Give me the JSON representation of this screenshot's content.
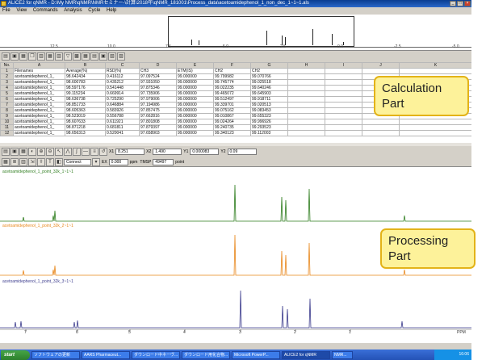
{
  "window": {
    "title": "ALICE2 for qNMR - D:\\My NMR\\qNMR\\NMRセミナー-\\計算\\2018年\\qNMR_181001\\Process_data\\acetoamidephenol_1_non_dec_1~1~1.als",
    "min": "_",
    "max": "□",
    "close": "×"
  },
  "menu": [
    "File",
    "View",
    "Commands",
    "Analysis",
    "Cycle",
    "Help"
  ],
  "overview": {
    "ticks": [
      "12.5",
      "10.0",
      "7.5",
      "5.0",
      "2.5",
      "0.0",
      "-2.5",
      "-5.0"
    ]
  },
  "sheet": {
    "columns": [
      "No.",
      "A",
      "B",
      "C",
      "D",
      "E",
      "F",
      "G",
      "H",
      "I",
      "J",
      "K"
    ],
    "header_row": [
      "1",
      "Filenames",
      "Average(%)",
      "RSD(%)",
      "CH3",
      "ETM(IS)",
      "CH2",
      "CH2"
    ],
    "rows": [
      [
        "2",
        "acetoamidephenol_1_",
        "98.642434",
        "0.416112",
        "97.097524",
        "99.000000",
        "99.799982",
        "99.070766"
      ],
      [
        "3",
        "acetoamidephenol_1_",
        "98.600783",
        "0.435212",
        "97.931050",
        "99.000000",
        "99.745774",
        "99.025518"
      ],
      [
        "4",
        "acetoamidephenol_1_",
        "98.597176",
        "0.541448",
        "97.875346",
        "99.000000",
        "99.022235",
        "99.640246"
      ],
      [
        "5",
        "acetoamidephenol_1_",
        "99.115234",
        "0.669914",
        "97.735906",
        "99.000000",
        "99.465072",
        "99.645903"
      ],
      [
        "6",
        "acetoamidephenol_1_",
        "98.636738",
        "0.725290",
        "97.979006",
        "99.000000",
        "99.512497",
        "99.918711"
      ],
      [
        "7",
        "acetoamidephenol_1_",
        "98.851733",
        "0.646884",
        "97.194986",
        "99.000000",
        "99.339701",
        "99.020513"
      ],
      [
        "8",
        "acetoamidephenol_1_",
        "98.605363",
        "0.583926",
        "97.857475",
        "99.000000",
        "99.075162",
        "99.083453"
      ],
      [
        "9",
        "acetoamidephenol_1_",
        "98.523019",
        "0.556788",
        "97.662816",
        "99.000000",
        "99.010867",
        "99.655323"
      ],
      [
        "10",
        "acetoamidephenol_1_",
        "98.607633",
        "0.611921",
        "97.801808",
        "99.000000",
        "99.024264",
        "99.996926"
      ],
      [
        "11",
        "acetoamidephenol_1_",
        "98.871218",
        "0.681811",
        "97.879397",
        "99.000000",
        "99.240735",
        "99.293523"
      ],
      [
        "12",
        "acetoamidephenol_1_",
        "98.656313",
        "0.520041",
        "97.658903",
        "99.000000",
        "99.340123",
        "99.112003"
      ]
    ]
  },
  "toolbar2": {
    "field1_label": "X1",
    "field1": "8.251",
    "field2_label": "X2",
    "field2": "1.490",
    "field3_label": "Y1",
    "field3": "0.000083",
    "field4_label": "Y2",
    "field4": "0.09"
  },
  "toolbar3": {
    "mode": "Connect",
    "ex_label": "EX",
    "ex_value": "0.000",
    "ex_unit": "ppm",
    "tmsp_label": "TMSP",
    "tmsp_value": "49497",
    "tmsp_unit": "point"
  },
  "spectra": {
    "labels": [
      {
        "text": "acetoamidephenol_1_point_32k_1~1~1",
        "color": "#2e7d1e"
      },
      {
        "text": "acetoamidephenol_1_point_32k_2~1~1",
        "color": "#e8861a"
      },
      {
        "text": "acetoamidephenol_1_point_32k_3~1~1",
        "color": "#3a3a8c"
      }
    ],
    "ppm_ticks": [
      "7",
      "6",
      "5",
      "4",
      "3",
      "2",
      "1"
    ],
    "ppm_unit": "PPM"
  },
  "taskbar": {
    "start": "start",
    "tasks": [
      "ソフトウェアの更新",
      "AARS Pharmaceut...",
      "ダウンロード中ネーヴ...",
      "ダウンロード用化合物...",
      "Microsoft PowerP...",
      "ALICE2 for qNMR",
      "NMR..."
    ],
    "clock": "16:06"
  },
  "callouts": {
    "calc_line1": "Calculation",
    "calc_line2": "Part",
    "proc_line1": "Processing",
    "proc_line2": "Part"
  },
  "colors": {
    "spec1": "#2e7d1e",
    "spec2": "#e8861a",
    "spec3": "#3a3a8c",
    "callout_fill": "#fdf29a",
    "callout_border": "#e3b318"
  }
}
